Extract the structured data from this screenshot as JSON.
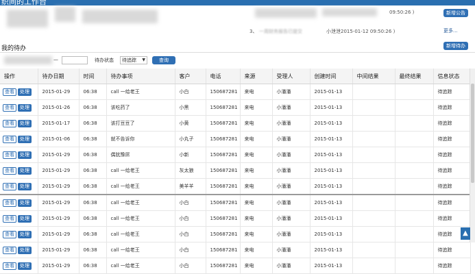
{
  "header": {
    "title": "织间的工作台"
  },
  "notices": {
    "line1_time": "09:50:26 )",
    "line3_number": "3、",
    "line3_text": "一周财务报告已提交",
    "line3_meta": "小泄泄2015-01-12 09:50:26 )",
    "new_notice_label": "新增公告",
    "more_label": "更多..."
  },
  "todo": {
    "section_title": "我的待办",
    "new_todo_label": "新增待办",
    "date_sep": "—",
    "status_label": "待办状态",
    "status_selected": "待追踪",
    "query_label": "查询",
    "columns": [
      "操作",
      "待办日期",
      "时间",
      "待办事项",
      "客户",
      "电话",
      "来源",
      "受理人",
      "创建时间",
      "中间结果",
      "最终结果",
      "信息状态"
    ],
    "view_label": "查看",
    "handle_label": "处理",
    "rows": [
      {
        "date": "2015-01-29",
        "time": "06:38",
        "item": "call 一给老王",
        "customer": "小白",
        "phone": "150687281",
        "source": "来电",
        "handler": "小潘潘",
        "created": "2015-01-13",
        "mid": "",
        "final": "",
        "status": "待追踪"
      },
      {
        "date": "2015-01-26",
        "time": "06:38",
        "item": "该吃药了",
        "customer": "小黑",
        "phone": "150687281",
        "source": "来电",
        "handler": "小潘潘",
        "created": "2015-01-13",
        "mid": "",
        "final": "",
        "status": "待追踪"
      },
      {
        "date": "2015-01-17",
        "time": "06:38",
        "item": "该打豆豆了",
        "customer": "小黄",
        "phone": "150687281",
        "source": "来电",
        "handler": "小潘潘",
        "created": "2015-01-13",
        "mid": "",
        "final": "",
        "status": "待追踪"
      },
      {
        "date": "2015-01-06",
        "time": "06:38",
        "item": "就不告诉你",
        "customer": "小丸子",
        "phone": "150687281",
        "source": "来电",
        "handler": "小潘潘",
        "created": "2015-01-13",
        "mid": "",
        "final": "",
        "status": "待追踪"
      },
      {
        "date": "2015-01-29",
        "time": "06:38",
        "item": "偶犹豫屌",
        "customer": "小新",
        "phone": "150687281",
        "source": "来电",
        "handler": "小潘潘",
        "created": "2015-01-13",
        "mid": "",
        "final": "",
        "status": "待追踪"
      },
      {
        "date": "2015-01-29",
        "time": "06:38",
        "item": "call 一给老王",
        "customer": "灰太狼",
        "phone": "150687281",
        "source": "来电",
        "handler": "小潘潘",
        "created": "2015-01-13",
        "mid": "",
        "final": "",
        "status": "待追踪"
      },
      {
        "date": "2015-01-29",
        "time": "06:38",
        "item": "call 一给老王",
        "customer": "美羊羊",
        "phone": "150687281",
        "source": "来电",
        "handler": "小潘潘",
        "created": "2015-01-13",
        "mid": "",
        "final": "",
        "status": "待追踪"
      },
      {
        "date": "2015-01-29",
        "time": "06:38",
        "item": "call 一给老王",
        "customer": "小白",
        "phone": "150687281",
        "source": "来电",
        "handler": "小潘潘",
        "created": "2015-01-13",
        "mid": "",
        "final": "",
        "status": "待追踪"
      },
      {
        "date": "2015-01-29",
        "time": "06:38",
        "item": "call 一给老王",
        "customer": "小白",
        "phone": "150687281",
        "source": "来电",
        "handler": "小潘潘",
        "created": "2015-01-13",
        "mid": "",
        "final": "",
        "status": "待追踪"
      },
      {
        "date": "2015-01-29",
        "time": "06:38",
        "item": "call 一给老王",
        "customer": "小白",
        "phone": "150687281",
        "source": "来电",
        "handler": "小潘潘",
        "created": "2015-01-13",
        "mid": "",
        "final": "",
        "status": "待追踪"
      },
      {
        "date": "2015-01-29",
        "time": "06:38",
        "item": "call 一给老王",
        "customer": "小白",
        "phone": "150687281",
        "source": "来电",
        "handler": "小潘潘",
        "created": "2015-01-13",
        "mid": "",
        "final": "",
        "status": "待追踪"
      },
      {
        "date": "2015-01-29",
        "time": "06:38",
        "item": "call 一给老王",
        "customer": "小白",
        "phone": "150687281",
        "source": "来电",
        "handler": "小潘潘",
        "created": "2015-01-13",
        "mid": "",
        "final": "",
        "status": "待追踪"
      }
    ]
  },
  "scroll_top_icon": "arrow-up-icon"
}
